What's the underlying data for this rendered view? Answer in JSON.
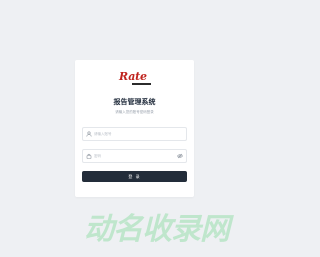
{
  "logo": {
    "text": "Rate",
    "alt": "Rate logo"
  },
  "login": {
    "title": "报告管理系统",
    "subtitle": "请输入您的账号密码登录",
    "username_placeholder": "请输入账号",
    "password_placeholder": "密码",
    "submit_label": "登 录"
  },
  "icons": {
    "username": "user-icon",
    "password": "lock-icon",
    "toggle_password": "eye-icon"
  },
  "watermark": {
    "text": "动名收录网"
  },
  "colors": {
    "background": "#eef0f3",
    "card": "#ffffff",
    "title": "#1f2a3a",
    "button": "#232d3a",
    "logo_red": "#c0241e",
    "watermark": "#bfe6cc"
  }
}
